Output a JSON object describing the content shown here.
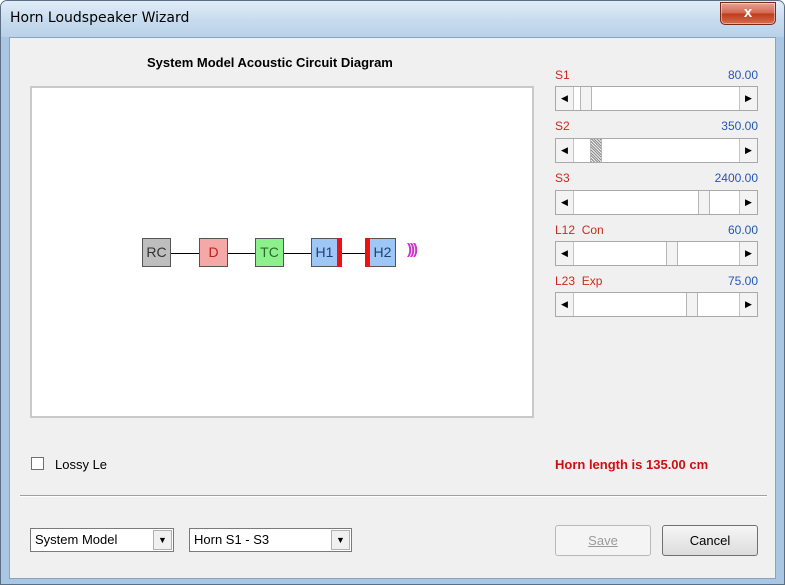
{
  "window": {
    "title": "Horn Loudspeaker Wizard",
    "close_label": "x"
  },
  "diagram": {
    "title": "System Model Acoustic Circuit Diagram",
    "blocks": [
      "RC",
      "D",
      "TC",
      "H1",
      "H2"
    ],
    "sound_glyph": ")))",
    "colors": {
      "RC": "#bebebe",
      "D": "#f4a8a8",
      "TC": "#8cf08c",
      "H1": "#9fc7f5",
      "H2": "#9fc7f5",
      "bar": "#ee1111"
    }
  },
  "sliders": [
    {
      "label": "S1",
      "value": "80.00",
      "position": 0.03
    },
    {
      "label": "S2",
      "value": "350.00",
      "position": 0.12
    },
    {
      "label": "S3",
      "value": "2400.00",
      "position": 0.82
    },
    {
      "label": "L12  Con",
      "value": "60.00",
      "position": 0.63
    },
    {
      "label": "L23  Exp",
      "value": "75.00",
      "position": 0.74
    }
  ],
  "options": {
    "lossy_label": "Lossy Le",
    "lossy_checked": false
  },
  "status": {
    "horn_length": "Horn length is 135.00 cm"
  },
  "footer": {
    "model_select": "System Model",
    "horn_select": "Horn S1 - S3",
    "save_label": "Save",
    "cancel_label": "Cancel"
  }
}
